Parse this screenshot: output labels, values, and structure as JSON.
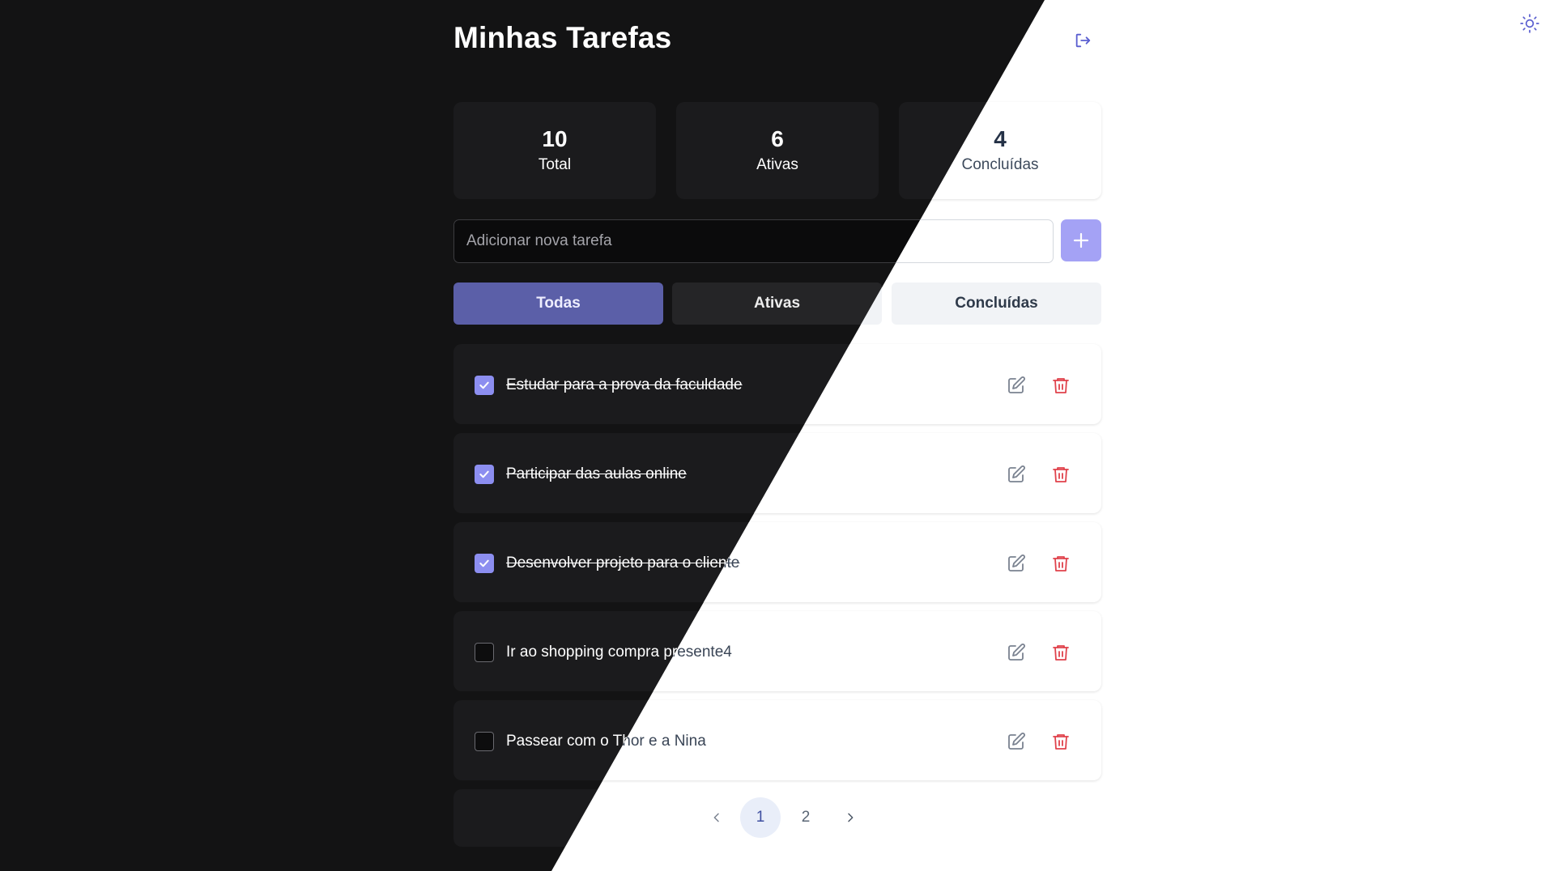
{
  "header": {
    "title": "Minhas Tarefas",
    "logout_icon": "logout-icon",
    "theme_toggle_icon": "sun-icon"
  },
  "stats": [
    {
      "value": "10",
      "label": "Total"
    },
    {
      "value": "6",
      "label": "Ativas"
    },
    {
      "value": "4",
      "label": "Concluídas"
    }
  ],
  "new_task": {
    "placeholder": "Adicionar nova tarefa",
    "add_icon": "plus-icon"
  },
  "filters": [
    {
      "label": "Todas",
      "active": true
    },
    {
      "label": "Ativas",
      "active": false
    },
    {
      "label": "Concluídas",
      "active": false
    }
  ],
  "tasks": [
    {
      "text": "Estudar para a prova da faculdade",
      "completed": true
    },
    {
      "text": "Participar das aulas online",
      "completed": true
    },
    {
      "text": "Desenvolver projeto para o cliente",
      "completed": true
    },
    {
      "text": "Ir ao shopping compra presente4",
      "completed": false
    },
    {
      "text": "Passear com o Thor e a Nina",
      "completed": false
    }
  ],
  "pagination": {
    "pages": [
      "1",
      "2"
    ],
    "current": "1",
    "prev_icon": "chevron-left-icon",
    "next_icon": "chevron-right-icon"
  },
  "colors": {
    "accent": "#5b5fa8",
    "checkbox": "#8c8ef0",
    "delete": "#e0424b",
    "dark_bg": "#131314",
    "light_bg": "#ffffff"
  }
}
